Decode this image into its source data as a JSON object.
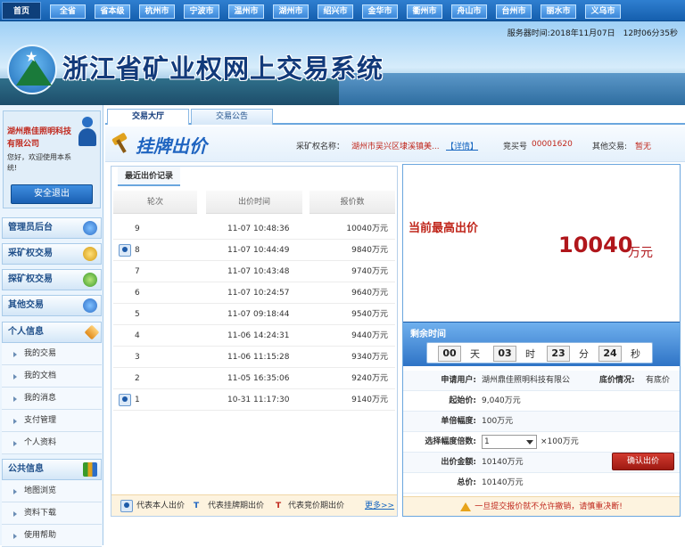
{
  "nav": {
    "home": "首页",
    "regions": [
      "全省",
      "省本级",
      "杭州市",
      "宁波市",
      "温州市",
      "湖州市",
      "绍兴市",
      "金华市",
      "衢州市",
      "舟山市",
      "台州市",
      "丽水市",
      "义乌市"
    ]
  },
  "banner": {
    "title": "浙江省矿业权网上交易系统",
    "server_time": "服务器时间:2018年11月07日　12时06分35秒"
  },
  "sidebar": {
    "company": "湖州鼎佳照明科技有限公司",
    "welcome": "您好，欢迎使用本系统!",
    "logout": "安全退出",
    "sections": [
      {
        "title": "管理员后台"
      },
      {
        "title": "采矿权交易"
      },
      {
        "title": "探矿权交易"
      },
      {
        "title": "其他交易"
      },
      {
        "title": "个人信息"
      },
      {
        "title": "公共信息"
      }
    ],
    "personal_items": [
      "我的交易",
      "我的文档",
      "我的消息",
      "支付管理",
      "个人资料"
    ],
    "public_items": [
      "地图浏览",
      "资料下载",
      "使用帮助"
    ]
  },
  "tabs": [
    "交易大厅",
    "交易公告"
  ],
  "listing": {
    "title": "挂牌出价",
    "mine_label": "采矿权名称：",
    "mine_name": "湖州市吴兴区埭溪镇美...",
    "detail_link": "【详情】",
    "bid_no_label": "竞买号",
    "bid_no": "00001620",
    "other_label": "其他交易:",
    "other_value": "暂无"
  },
  "bid_records": {
    "tab": "最近出价记录",
    "columns": [
      "轮次",
      "出价时间",
      "报价数"
    ],
    "rows": [
      {
        "round": "9",
        "time": "11-07 10:48:36",
        "price": "10040万元",
        "self": false
      },
      {
        "round": "8",
        "time": "11-07 10:44:49",
        "price": "9840万元",
        "self": true
      },
      {
        "round": "7",
        "time": "11-07 10:43:48",
        "price": "9740万元",
        "self": false
      },
      {
        "round": "6",
        "time": "11-07 10:24:57",
        "price": "9640万元",
        "self": false
      },
      {
        "round": "5",
        "time": "11-07 09:18:44",
        "price": "9540万元",
        "self": false
      },
      {
        "round": "4",
        "time": "11-06 14:24:31",
        "price": "9440万元",
        "self": false
      },
      {
        "round": "3",
        "time": "11-06 11:15:28",
        "price": "9340万元",
        "self": false
      },
      {
        "round": "2",
        "time": "11-05 16:35:06",
        "price": "9240万元",
        "self": false
      },
      {
        "round": "1",
        "time": "10-31 11:17:30",
        "price": "9140万元",
        "self": true
      }
    ],
    "legend": {
      "self": "代表本人出价",
      "listing_mark": "T",
      "listing": "代表挂牌期出价",
      "auction_mark": "T",
      "auction": "代表竞价期出价",
      "more": "更多>>"
    }
  },
  "highest": {
    "label": "当前最高出价",
    "value": "10040",
    "unit": "万元"
  },
  "remaining": {
    "title": "剩余时间",
    "days": "00",
    "days_unit": "天",
    "hours": "03",
    "hours_unit": "时",
    "minutes": "23",
    "minutes_unit": "分",
    "seconds": "24",
    "seconds_unit": "秒"
  },
  "bid_form": {
    "applicant_label": "申请用户:",
    "applicant": "湖州鼎佳照明科技有限公",
    "reserve_label": "底价情况:",
    "reserve": "有底价",
    "start_label": "起始价:",
    "start": "9,040万元",
    "step_label": "单倍幅度:",
    "step": "100万元",
    "multiple_label": "选择幅度倍数:",
    "multiple": "1",
    "multiple_suffix": "×100万元",
    "amount_label": "出价金额:",
    "amount": "10140万元",
    "total_label": "总价:",
    "total": "10140万元",
    "confirm": "确认出价",
    "warning": "一旦提交报价就不允许撤销，请慎重决断!"
  }
}
